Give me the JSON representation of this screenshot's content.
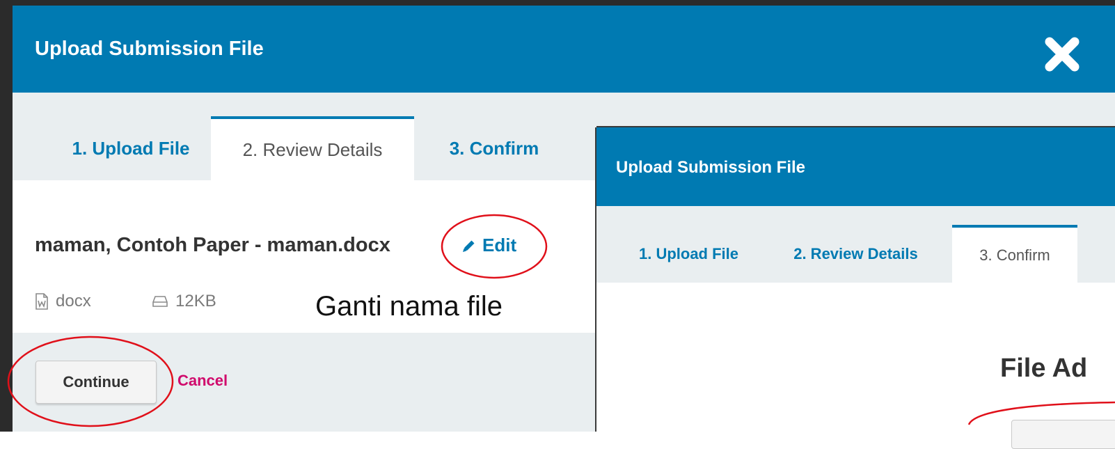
{
  "dialog_main": {
    "title": "Upload Submission File",
    "tabs": [
      {
        "label": "1. Upload File"
      },
      {
        "label": "2. Review Details"
      },
      {
        "label": "3. Confirm"
      }
    ],
    "file": {
      "name": "maman, Contoh Paper - maman.docx",
      "edit_label": "Edit",
      "type": "docx",
      "size": "12KB"
    },
    "annotation": "Ganti nama file",
    "buttons": {
      "continue": "Continue",
      "cancel": "Cancel"
    }
  },
  "dialog_overlay": {
    "title": "Upload Submission File",
    "tabs": [
      {
        "label": "1. Upload File"
      },
      {
        "label": "2. Review Details"
      },
      {
        "label": "3. Confirm"
      }
    ],
    "message": "File Ad"
  },
  "icons": {
    "close": "close-icon",
    "edit": "pencil-icon",
    "file_type": "word-file-icon",
    "size": "drive-icon"
  },
  "colors": {
    "header": "#007ab2",
    "tab_bar": "#e9eef0",
    "link": "#007ab2",
    "cancel": "#d00a6c",
    "annotation": "#e0101a"
  }
}
